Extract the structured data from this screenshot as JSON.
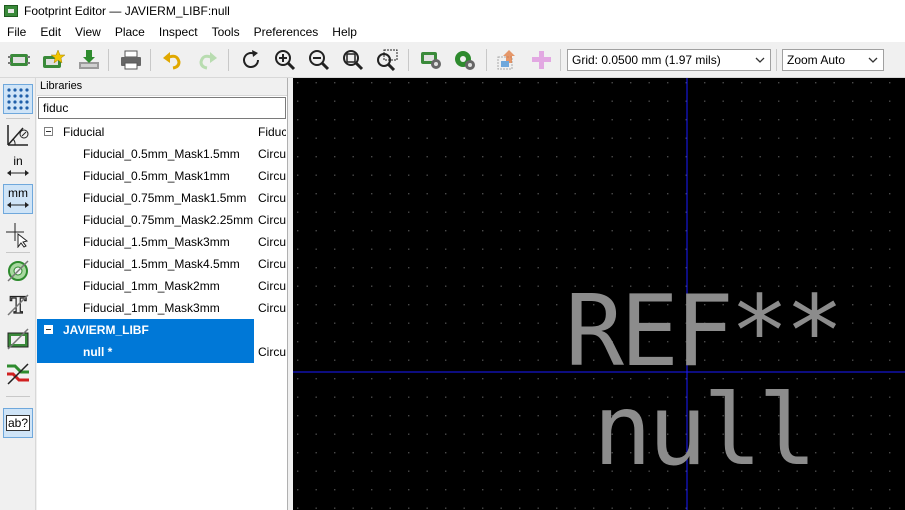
{
  "window": {
    "title": "Footprint Editor — JAVIERM_LIBF:null"
  },
  "menu": [
    "File",
    "Edit",
    "View",
    "Place",
    "Inspect",
    "Tools",
    "Preferences",
    "Help"
  ],
  "toolbar": {
    "grid_value": "Grid: 0.0500 mm (1.97 mils)",
    "zoom_value": "Zoom Auto"
  },
  "left_toolbar": {
    "units_in": "in",
    "units_mm": "mm",
    "text_tool": "ab?"
  },
  "libraries": {
    "header": "Libraries",
    "search_value": "fiduc",
    "groups": [
      {
        "name": "Fiducial",
        "desc": "Fiducial",
        "items": [
          {
            "name": "Fiducial_0.5mm_Mask1.5mm",
            "desc": "Circular"
          },
          {
            "name": "Fiducial_0.5mm_Mask1mm",
            "desc": "Circular"
          },
          {
            "name": "Fiducial_0.75mm_Mask1.5mm",
            "desc": "Circular"
          },
          {
            "name": "Fiducial_0.75mm_Mask2.25mm",
            "desc": "Circular"
          },
          {
            "name": "Fiducial_1.5mm_Mask3mm",
            "desc": "Circular"
          },
          {
            "name": "Fiducial_1.5mm_Mask4.5mm",
            "desc": "Circular"
          },
          {
            "name": "Fiducial_1mm_Mask2mm",
            "desc": "Circular"
          },
          {
            "name": "Fiducial_1mm_Mask3mm",
            "desc": "Circular"
          }
        ]
      },
      {
        "name": "JAVIERM_LIBF",
        "desc": "",
        "items": [
          {
            "name": "null *",
            "desc": "Circular"
          }
        ]
      }
    ]
  },
  "canvas": {
    "reference": "REF**",
    "value": "null",
    "background": "#000000",
    "axis_color": "#1a1aff",
    "text_color": "#8c8c8c",
    "grid_dot_color": "#4a4a4a"
  },
  "colors": {
    "selection": "#0078d7",
    "accent_green": "#3a8a3a"
  }
}
